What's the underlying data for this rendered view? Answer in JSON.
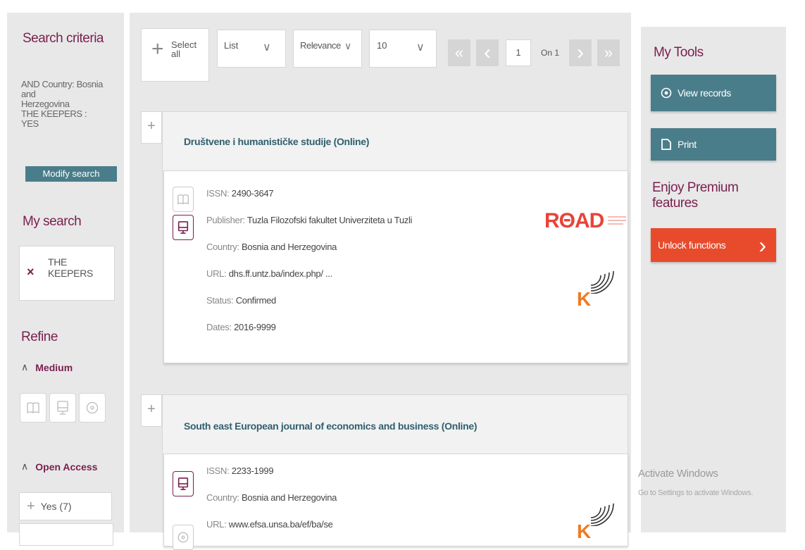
{
  "sidebar": {
    "search_criteria_title": "Search criteria",
    "criteria_lines": [
      "AND Country: Bosnia",
      "and",
      "Herzegovina",
      "THE KEEPERS :",
      "YES"
    ],
    "modify_search": "Modify search",
    "my_search_title": "My search",
    "search_term_line1": "THE",
    "search_term_line2": "KEEPERS",
    "remove_mark": "×",
    "refine_title": "Refine",
    "medium_label": "Medium",
    "open_access_label": "Open Access",
    "yes_count": "Yes (7)",
    "chevron_up": "∧",
    "plus": "+"
  },
  "toolbar": {
    "select_all_line1": "Select",
    "select_all_line2": "all",
    "view_mode": "List",
    "sort": "Relevance",
    "per_page": "10",
    "dropdown_caret": "∨",
    "page_input": "1",
    "page_of": "On 1",
    "first": "«",
    "prev": "‹",
    "next": "›",
    "last": "»"
  },
  "records": [
    {
      "title": "Društvene i humanističke studije (Online)",
      "issn_label": "ISSN:",
      "issn": "2490-3647",
      "publisher_label": "Publisher:",
      "publisher": "Tuzla Filozofski fakultet Univerziteta u Tuzli",
      "country_label": "Country:",
      "country": "Bosnia and Herzegovina",
      "url_label": "URL:",
      "url": "dhs.ff.untz.ba/index.php/ ...",
      "status_label": "Status:",
      "status": "Confirmed",
      "dates_label": "Dates:",
      "dates": "2016-9999",
      "road_logo": "RΘAD",
      "k_logo": "K"
    },
    {
      "title": "South east European journal of economics and business (Online)",
      "issn_label": "ISSN:",
      "issn": "2233-1999",
      "country_label": "Country:",
      "country": "Bosnia and Herzegovina",
      "url_label": "URL:",
      "url": "www.efsa.unsa.ba/ef/ba/se",
      "k_logo": "K"
    }
  ],
  "tools": {
    "title": "My Tools",
    "view_records": "View records",
    "print": "Print",
    "premium_title": "Enjoy Premium features",
    "unlock": "Unlock functions",
    "unlock_arrow": "›"
  },
  "watermark": {
    "line1": "Activate Windows",
    "line2": "Go to Settings to activate Windows."
  },
  "colors": {
    "accent_purple": "#7a1f4f",
    "teal": "#4a7d8a",
    "unlock_red": "#e84b2c",
    "road_red": "#e8433a",
    "k_orange": "#f07a22"
  }
}
